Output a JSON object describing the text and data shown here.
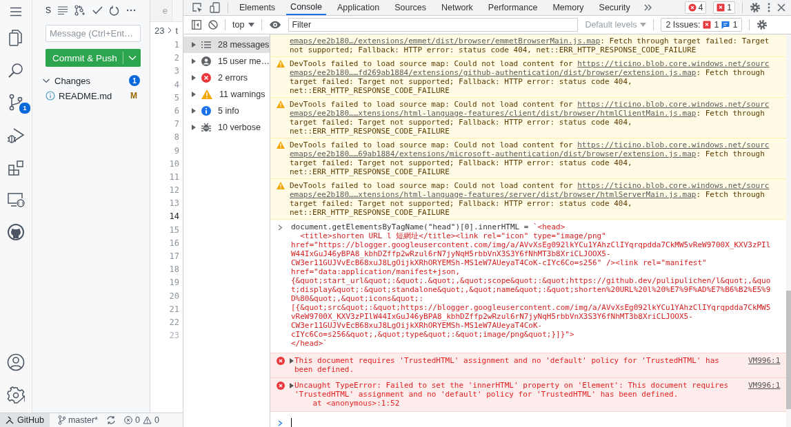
{
  "vscode": {
    "activity_bar": {
      "top": [
        {
          "kind": "files"
        },
        {
          "kind": "search"
        },
        {
          "kind": "scm",
          "badge": "1"
        },
        {
          "kind": "run"
        },
        {
          "kind": "extensions"
        },
        {
          "kind": "remote"
        },
        {
          "kind": "github"
        }
      ],
      "bottom": [
        {
          "kind": "account"
        },
        {
          "kind": "settings"
        }
      ]
    },
    "scm": {
      "title": "S",
      "message_placeholder": "Message (Ctrl+Ent…",
      "commit_button": "Commit & Push",
      "changes": {
        "label": "Changes",
        "count": "1",
        "expanded": true,
        "files": [
          {
            "name": "README.md",
            "status": "M"
          }
        ]
      }
    },
    "editor": {
      "tab_label": "e",
      "breadcrumb": [
        "23",
        "t"
      ],
      "lines": [
        {
          "number": "1",
          "current": false,
          "faded": false
        },
        {
          "number": "2",
          "current": false,
          "faded": false
        },
        {
          "number": "3",
          "current": false,
          "faded": false
        },
        {
          "number": "4",
          "current": false,
          "faded": false
        },
        {
          "number": "5",
          "current": false,
          "faded": false
        },
        {
          "number": "6",
          "current": false,
          "faded": false
        },
        {
          "number": "7",
          "current": false,
          "faded": false
        },
        {
          "number": "8",
          "current": false,
          "faded": false
        },
        {
          "number": "9",
          "current": false,
          "faded": false
        },
        {
          "number": "10",
          "current": false,
          "faded": false
        },
        {
          "number": "11",
          "current": false,
          "faded": false
        },
        {
          "number": "12",
          "current": false,
          "faded": false
        },
        {
          "number": "13",
          "current": false,
          "faded": false
        },
        {
          "number": "14",
          "current": true,
          "faded": false
        },
        {
          "number": "15",
          "current": false,
          "faded": false
        },
        {
          "number": "16",
          "current": false,
          "faded": false
        },
        {
          "number": "17",
          "current": false,
          "faded": false
        },
        {
          "number": "18",
          "current": false,
          "faded": false
        },
        {
          "number": "19",
          "current": false,
          "faded": false
        },
        {
          "number": "20",
          "current": false,
          "faded": false
        },
        {
          "number": "21",
          "current": false,
          "faded": false
        },
        {
          "number": "22",
          "current": false,
          "faded": false
        },
        {
          "number": "23",
          "current": false,
          "faded": true
        }
      ]
    },
    "status_bar": {
      "remote": "GitHub",
      "branch": "master*",
      "errors": "0",
      "warnings": "0"
    }
  },
  "devtools": {
    "tabs": [
      {
        "label": "Elements",
        "selected": false
      },
      {
        "label": "Console",
        "selected": true
      },
      {
        "label": "Application",
        "selected": false
      },
      {
        "label": "Sources",
        "selected": false
      },
      {
        "label": "Network",
        "selected": false
      },
      {
        "label": "Performance",
        "selected": false
      },
      {
        "label": "Memory",
        "selected": false
      },
      {
        "label": "Security",
        "selected": false
      }
    ],
    "error_badge": "4",
    "issue_badge": "1",
    "toolbar": {
      "context": "top",
      "filter_placeholder": "Filter",
      "levels": "Default levels",
      "issues_label": "2 Issues:",
      "issues_errors": "1",
      "issues_info": "1"
    },
    "sidebar": [
      {
        "kind": "all",
        "label": "28 messages",
        "selected": true
      },
      {
        "kind": "user",
        "label": "15 user me…",
        "selected": false
      },
      {
        "kind": "error",
        "label": "2 errors",
        "selected": false
      },
      {
        "kind": "warning",
        "label": "11 warnings",
        "selected": false
      },
      {
        "kind": "info",
        "label": "5 info",
        "selected": false
      },
      {
        "kind": "verbose",
        "label": "10 verbose",
        "selected": false
      }
    ],
    "messages": [
      {
        "kind": "warning",
        "cut_off": true,
        "parts": [
          {
            "link": "emaps/ee2b180…/extensions/emmet/dist/browser/emmetBrowserMain.js.map"
          },
          {
            "text": ": Fetch through target failed: Target not supported; Fallback: HTTP error: status code 404, net::ERR_HTTP_RESPONSE_CODE_FAILURE"
          }
        ]
      },
      {
        "kind": "warning",
        "cut_off": false,
        "parts": [
          {
            "text": "DevTools failed to load source map: Could not load content for "
          },
          {
            "link": "https://ticino.blob.core.windows.net/sourcemaps/ee2b180……fd269ab1884/extensions/github-authentication/dist/browser/extension.js.map"
          },
          {
            "text": ": Fetch through target failed: Target not supported; Fallback: HTTP error: status code 404, net::ERR_HTTP_RESPONSE_CODE_FAILURE"
          }
        ]
      },
      {
        "kind": "warning",
        "cut_off": false,
        "parts": [
          {
            "text": "DevTools failed to load source map: Could not load content for "
          },
          {
            "link": "https://ticino.blob.core.windows.net/sourcemaps/ee2b180……xtensions/html-language-features/client/dist/browser/htmlClientMain.js.map"
          },
          {
            "text": ": Fetch through target failed: Target not supported; Fallback: HTTP error: status code 404, net::ERR_HTTP_RESPONSE_CODE_FAILURE"
          }
        ]
      },
      {
        "kind": "warning",
        "cut_off": false,
        "parts": [
          {
            "text": "DevTools failed to load source map: Could not load content for "
          },
          {
            "link": "https://ticino.blob.core.windows.net/sourcemaps/ee2b180……69ab1884/extensions/microsoft-authentication/dist/browser/extension.js.map"
          },
          {
            "text": ": Fetch through target failed: Target not supported; Fallback: HTTP error: status code 404, net::ERR_HTTP_RESPONSE_CODE_FAILURE"
          }
        ]
      },
      {
        "kind": "warning",
        "cut_off": false,
        "parts": [
          {
            "text": "DevTools failed to load source map: Could not load content for "
          },
          {
            "link": "https://ticino.blob.core.windows.net/sourcemaps/ee2b180……xtensions/html-language-features/server/dist/browser/htmlServerMain.js.map"
          },
          {
            "text": ": Fetch through target failed: Target not supported; Fallback: HTTP error: status code 404, net::ERR_HTTP_RESPONSE_CODE_FAILURE"
          }
        ]
      },
      {
        "kind": "command",
        "code": "document.getElementsByTagName(\"head\")[0].innerHTML = ",
        "string": "`<head>\n  <title>shorten URL l 短網址</title><link rel=\"icon\" type=\"image/png\" href=\"https://blogger.googleusercontent.com/img/a/AVvXsEg092lkYCu1YAhzClIYqrqpdda7CkMW5vReW9700X_KXV3zPIlW44IxGuJ46yBPA8_kbhDZffp2wRzul6rN7jyNqH5rbbVnX3S3Y6fNhMT3b8XriCLJOOX5-CW3er11GUJVvEcB68xuJ8LgOijkXRhORYEMSh-MS1eW7AUeyaT4CoK-cIYc6Co=s256\" /><link rel=\"manifest\" href=\"data:application/manifest+json, {&quot;start_url&quot;:&quot;.&quot;,&quot;scope&quot;:&quot;https://github.dev/pulipulichen/l&quot;,&quot;display&quot;:&quot;standalone&quot;,&quot;name&quot;:&quot;shorten%20URL%20l%20%E7%9F%AD%E7%B6%B2%E5%9D%80&quot;,&quot;icons&quot;: [{&quot;src&quot;:&quot;https://blogger.googleusercontent.com/img/a/AVvXsEg092lkYCu1YAhzClIYqrqpdda7CkMW5vReW9700X_KXV3zPIlW44IxGuJ46yBPA8_kbhDZffp2wRzul6rN7jyNqH5rbbVnX3S3Y6fNhMT3b8XriCLJOOX5-CW3er11GUJVvEcB68xuJ8LgOijkXRhORYEMSh-MS1eW7AUeyaT4CoK-cIYc6Co=s256&quot;,&quot;type&quot;:&quot;image/png&quot;}]}\">\n</head>`"
      },
      {
        "kind": "error",
        "expandable": true,
        "text": "This document requires 'TrustedHTML' assignment and no 'default' policy for 'TrustedHTML' has been defined.",
        "source": "VM996:1"
      },
      {
        "kind": "error",
        "expandable": true,
        "text": "Uncaught TypeError: Failed to set the 'innerHTML' property on 'Element': This document requires 'TrustedHTML' assignment and no 'default' policy for 'TrustedHTML' has been defined.\n    at <anonymous>:1:52",
        "source": "VM996:1"
      }
    ]
  }
}
